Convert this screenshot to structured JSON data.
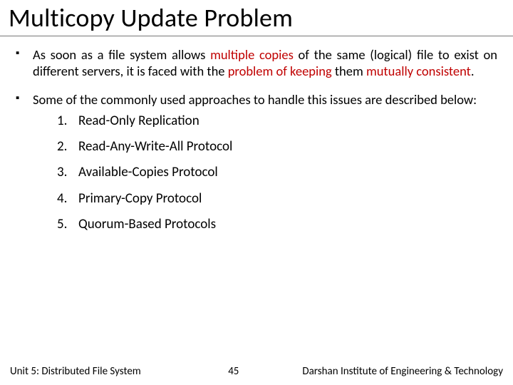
{
  "title": "Multicopy Update Problem",
  "bullets": [
    {
      "pre1": "As soon as a file system allows ",
      "hl1": "multiple copies",
      "mid1": " of the same (logical) file to exist on different servers, it is faced with the ",
      "hl2": "problem of keeping",
      "mid2": " them ",
      "hl3": "mutually consistent",
      "post": "."
    },
    {
      "pre1": "Some of the commonly used approaches to handle this issues are described below:",
      "hl1": "",
      "mid1": "",
      "hl2": "",
      "mid2": "",
      "hl3": "",
      "post": ""
    }
  ],
  "list": {
    "0": "Read-Only Replication",
    "1": "Read-Any-Write-All Protocol",
    "2": "Available-Copies Protocol",
    "3": "Primary-Copy Protocol",
    "4": "Quorum-Based Protocols"
  },
  "footer": {
    "unit": "Unit 5: Distributed File System",
    "page": "45",
    "org": "Darshan Institute of Engineering & Technology"
  }
}
